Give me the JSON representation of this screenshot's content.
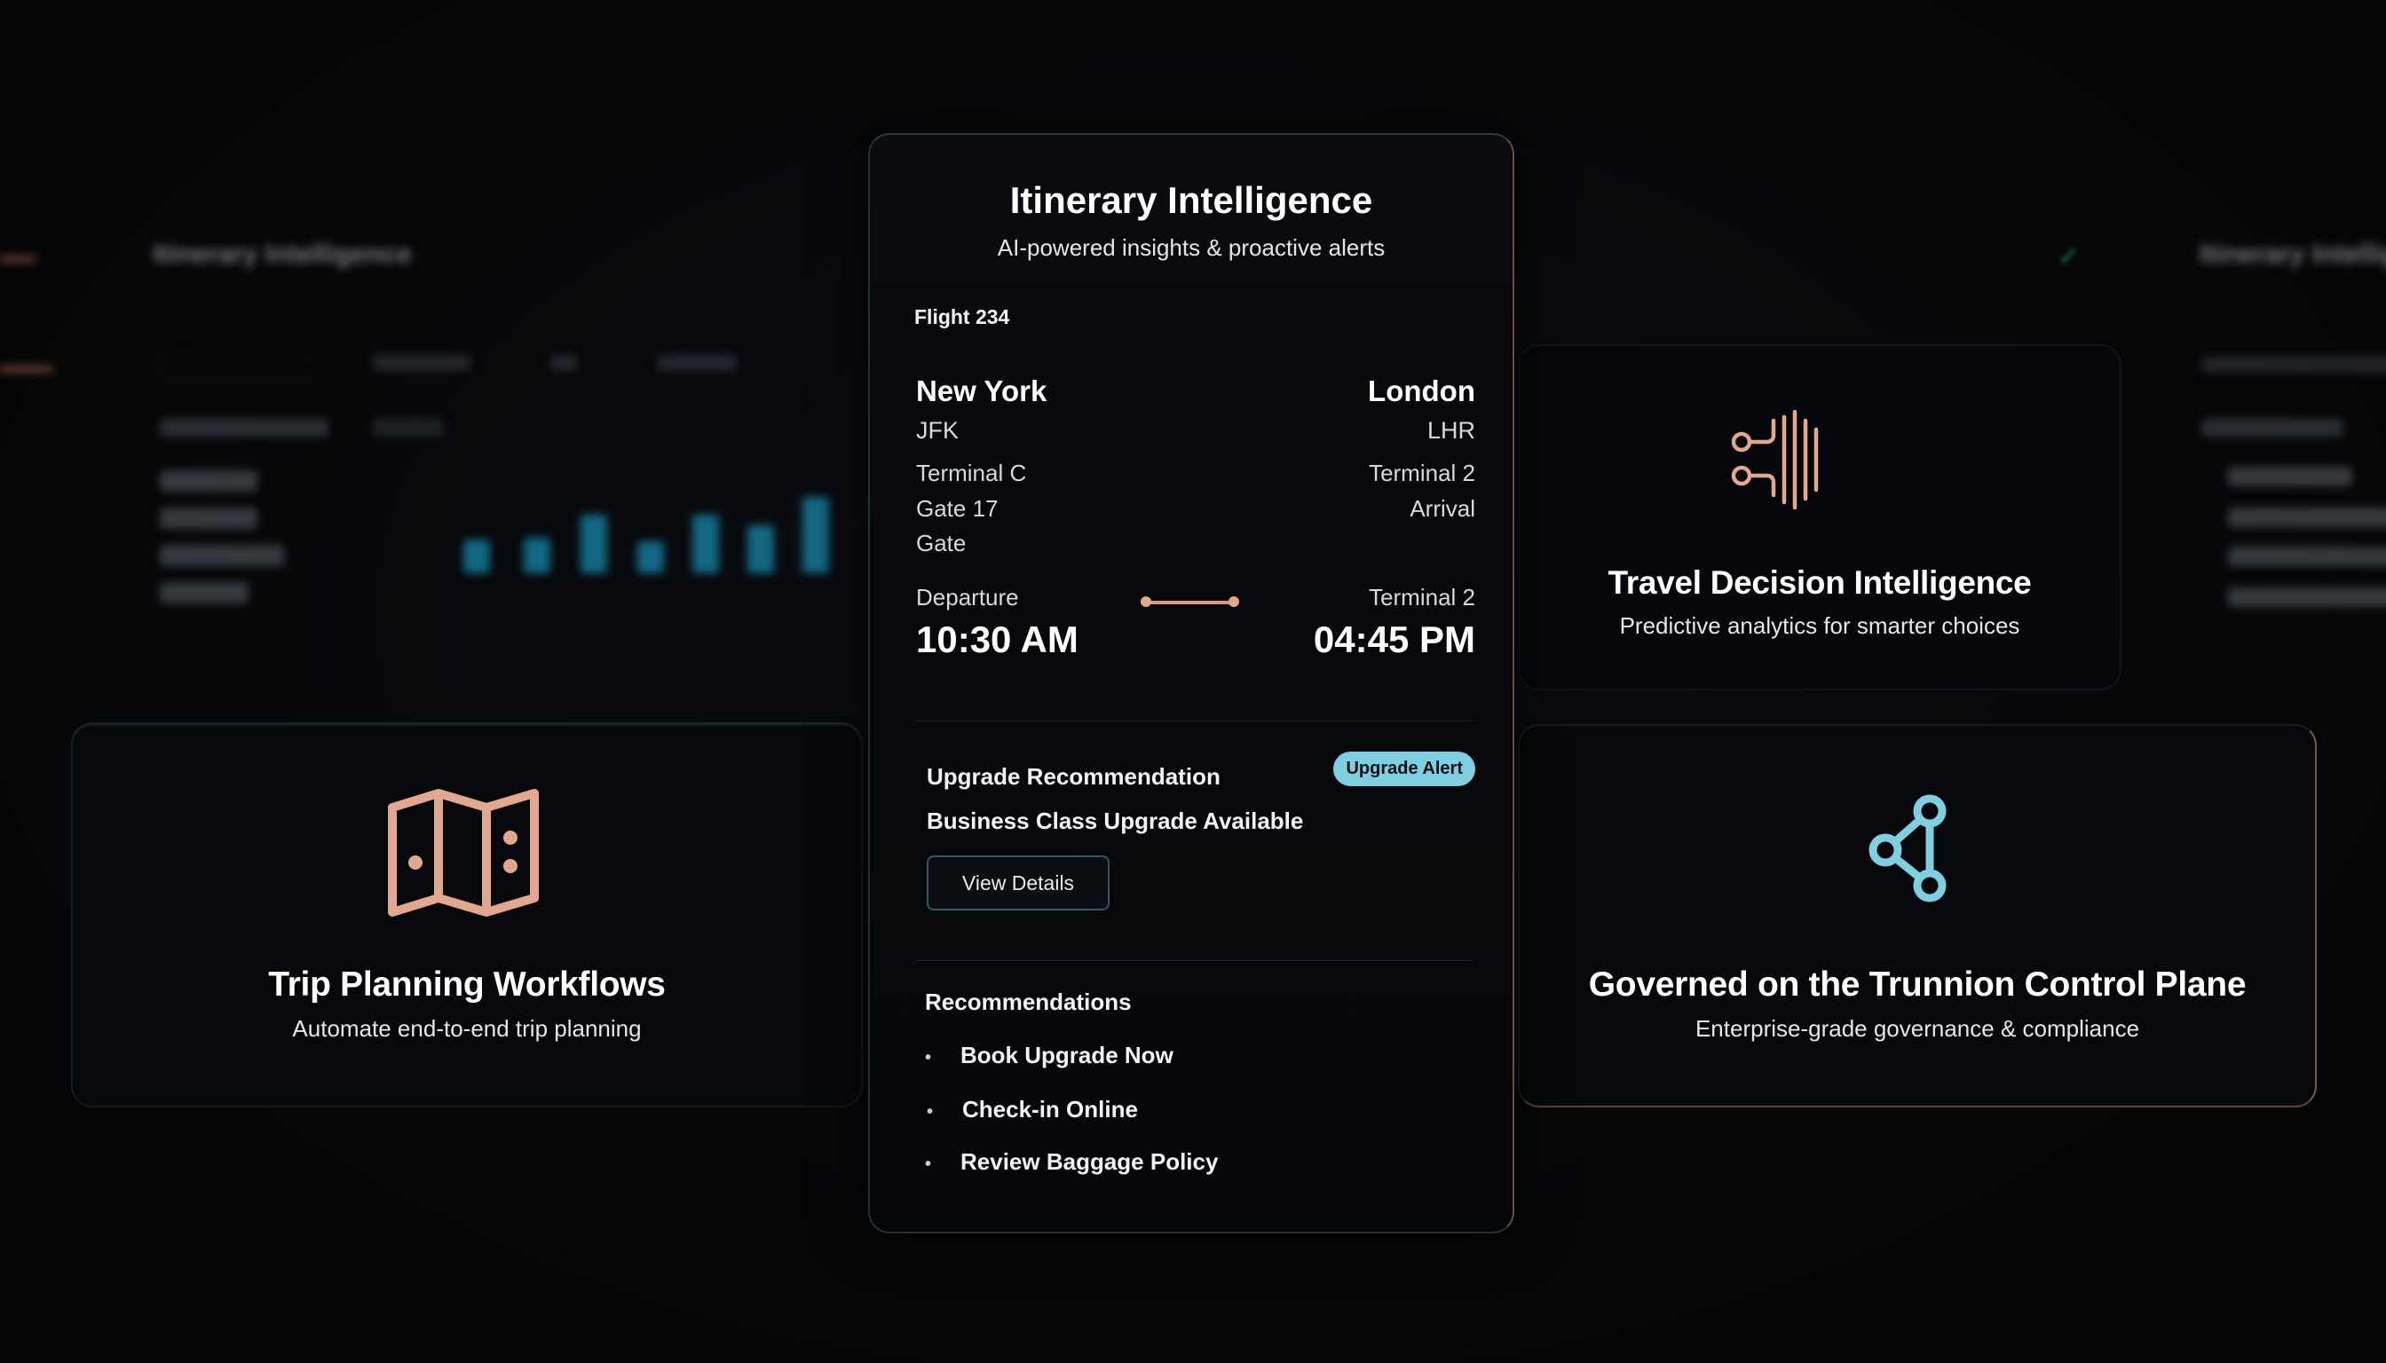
{
  "center_card": {
    "title": "Itinerary Intelligence",
    "subtitle": "AI-powered insights & proactive alerts",
    "flight_label": "Flight 234",
    "origin": {
      "city": "New York",
      "code": "JFK",
      "terminal": "Terminal C",
      "gate": "Gate 17",
      "gate_label": "Gate",
      "time_label": "Departure",
      "time": "10:30 AM"
    },
    "destination": {
      "city": "London",
      "code": "LHR",
      "terminal": "Terminal 2",
      "arrival_label": "Arrival",
      "time_label": "Terminal 2",
      "time": "04:45 PM"
    },
    "upgrade": {
      "title": "Upgrade Recommendation",
      "badge": "Upgrade Alert",
      "description": "Business Class Upgrade Available",
      "button": "View Details"
    },
    "recommendations": {
      "title": "Recommendations",
      "bullet": "•",
      "items": [
        "Book Upgrade Now",
        "Check-in Online",
        "Review Baggage Policy"
      ]
    }
  },
  "feature_cards": {
    "trip_planning": {
      "title": "Trip Planning Workflows",
      "subtitle": "Automate end-to-end trip planning",
      "icon": "map-icon"
    },
    "decision_intelligence": {
      "title": "Travel Decision Intelligence",
      "subtitle": "Predictive analytics for smarter choices",
      "icon": "data-stream-icon"
    },
    "governance": {
      "title": "Governed on the Trunnion Control Plane",
      "subtitle": "Enterprise-grade governance & compliance",
      "icon": "share-network-icon"
    }
  },
  "background": {
    "left_dashboard_title": "Itinerary Intelligence",
    "right_dashboard_title": "Itinerary Intelligence"
  },
  "colors": {
    "accent_teal": "#7ecfe0",
    "accent_peach": "#e2a88f",
    "bar_blue": "#1fb6e6",
    "background": "#050608"
  }
}
